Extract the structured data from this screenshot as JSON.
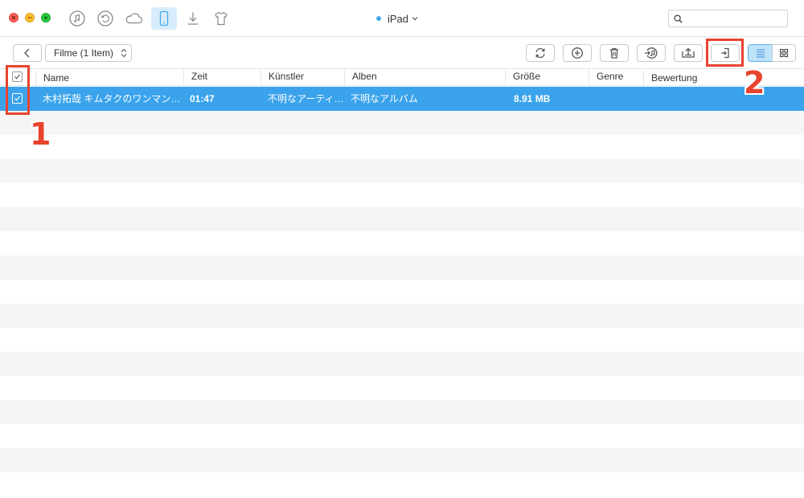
{
  "titlebar": {
    "device_name": "iPad",
    "search": {
      "placeholder": "",
      "value": ""
    },
    "nav_icons": [
      "music-icon",
      "restore-icon",
      "cloud-icon",
      "device-icon",
      "download-icon",
      "tshirt-icon"
    ]
  },
  "toolbar": {
    "category_label": "Filme (1 Item)",
    "buttons": [
      "refresh-icon",
      "add-icon",
      "delete-icon",
      "to-itunes-icon",
      "to-computer-icon",
      "to-device-icon"
    ],
    "views": [
      "list-view-icon",
      "grid-view-icon"
    ]
  },
  "table": {
    "columns": {
      "name": "Name",
      "time": "Zeit",
      "artist": "Künstler",
      "album": "Alben",
      "size": "Größe",
      "genre": "Genre",
      "rating": "Bewertung"
    },
    "rows": [
      {
        "name": "木村拓哉 キムタクのワンマン…",
        "time": "01:47",
        "artist": "不明なアーティ…",
        "album": "不明なアルバム",
        "size": "8.91 MB",
        "genre": "",
        "rating": "",
        "selected": true
      }
    ]
  },
  "annotations": {
    "marker_1": "1",
    "marker_2": "2"
  },
  "colors": {
    "accent": "#3aa3ec",
    "annotation": "#e8432e",
    "row_stripe": "#f5f5f5"
  }
}
